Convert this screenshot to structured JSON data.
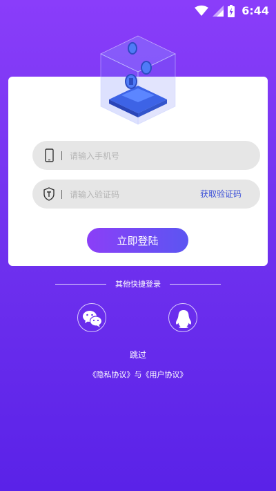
{
  "status_bar": {
    "time": "6:44"
  },
  "form": {
    "phone_placeholder": "请输入手机号",
    "code_placeholder": "请输入验证码",
    "get_code_label": "获取验证码",
    "login_label": "立即登陆"
  },
  "quick_login": {
    "title": "其他快捷登录",
    "options": [
      {
        "icon": "wechat-icon"
      },
      {
        "icon": "qq-icon"
      }
    ]
  },
  "skip_label": "跳过",
  "agreements": {
    "privacy": "《隐私协议》",
    "joiner": "与",
    "user": "《用户协议》"
  },
  "colors": {
    "background_top": "#8a3dfa",
    "background_bottom": "#5a22e8",
    "link": "#3a4fd8",
    "button_start": "#8b3ff7",
    "button_end": "#5c55f2"
  }
}
